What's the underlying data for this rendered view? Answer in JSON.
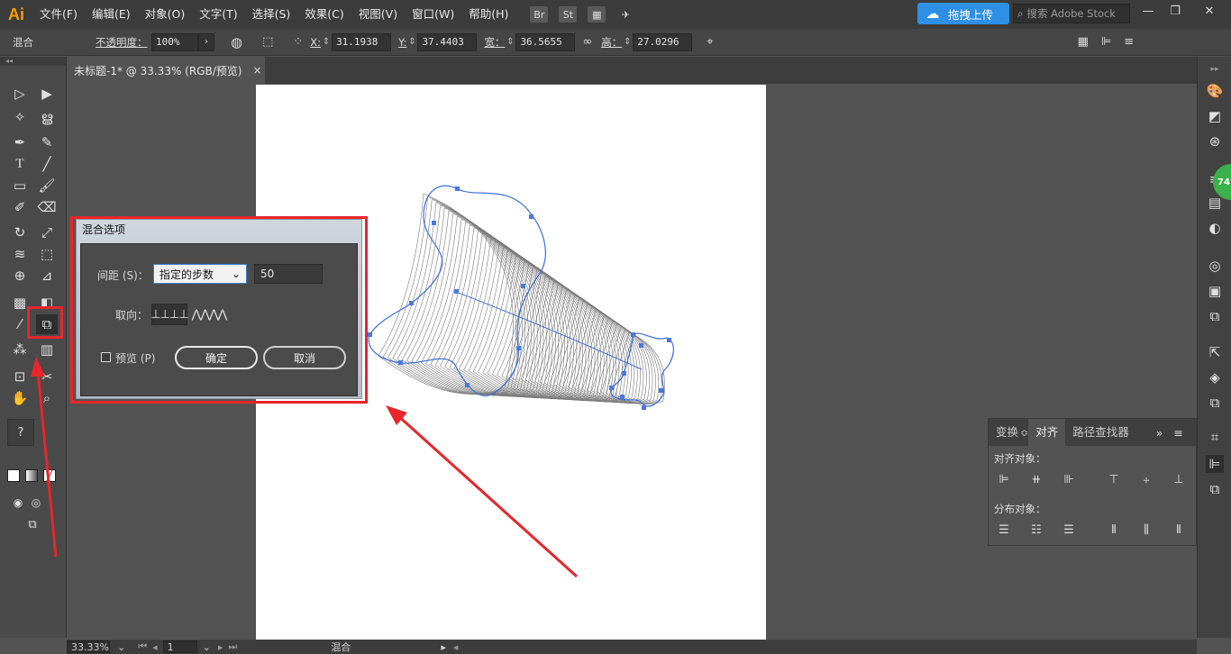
{
  "app": {
    "logo": "Ai",
    "menu": [
      "文件(F)",
      "编辑(E)",
      "对象(O)",
      "文字(T)",
      "选择(S)",
      "效果(C)",
      "视图(V)",
      "窗口(W)",
      "帮助(H)"
    ],
    "upload_label": "拖拽上传",
    "search_placeholder": "搜索 Adobe Stock"
  },
  "control_bar": {
    "mode_label": "混合",
    "opacity_label": "不透明度：",
    "opacity_value": "100%",
    "x_label": "X:",
    "x_value": "31.1938",
    "y_label": "Y:",
    "y_value": "37.4403",
    "w_label": "宽：",
    "w_value": "36.5655",
    "h_label": "高：",
    "h_value": "27.0296"
  },
  "document": {
    "tab_title": "未标题-1* @ 33.33% (RGB/预览)",
    "tab_close": "×"
  },
  "dialog": {
    "title": "混合选项",
    "spacing_label": "间距 (S)：",
    "spacing_option": "指定的步数",
    "spacing_value": "50",
    "orientation_label": "取向：",
    "preview_label": "预览 (P)",
    "ok_label": "确定",
    "cancel_label": "取消"
  },
  "align_panel": {
    "tabs": [
      "变换",
      "对齐",
      "路径查找器"
    ],
    "tab_divider": "≎",
    "expand": "»",
    "menu": "≡",
    "align_objects_label": "对齐对象：",
    "distribute_objects_label": "分布对象："
  },
  "status_bar": {
    "zoom": "33.33%",
    "artboard_number": "1",
    "tool_name": "混合"
  },
  "badge": {
    "value": "74"
  },
  "toolbar": {
    "help_mark": "?"
  },
  "colors": {
    "highlight": "#e8262b",
    "selection": "#3b6fd6",
    "upload_button": "#2e8fe6"
  }
}
